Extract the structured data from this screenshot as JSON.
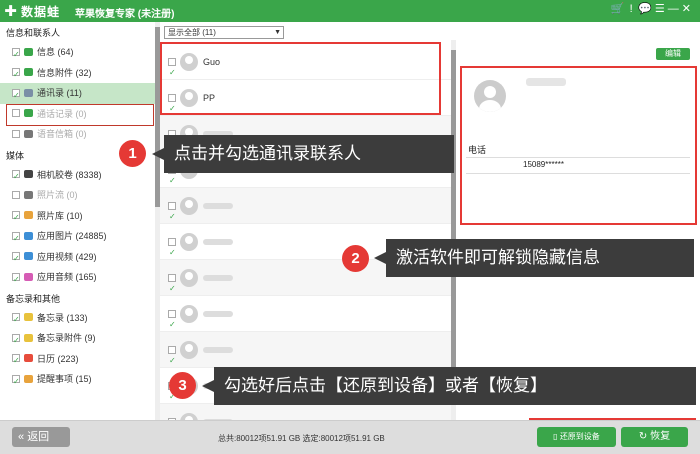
{
  "app": {
    "logo_text": "数据蛙",
    "title": "苹果恢复专家 (未注册)",
    "window_icons": [
      "🛒",
      "!",
      "💬",
      "☰",
      "—",
      "✕"
    ]
  },
  "search": {
    "placeholder": "搜索"
  },
  "sidebar": {
    "sections": [
      {
        "title": "信息和联系人",
        "items": [
          {
            "label": "信息 (64)",
            "checked": true,
            "color": "#3aa64a",
            "selected": false,
            "disabled": false
          },
          {
            "label": "信息附件 (32)",
            "checked": true,
            "color": "#3aa64a",
            "selected": false,
            "disabled": false
          },
          {
            "label": "通讯录 (11)",
            "checked": true,
            "color": "#7a8fa6",
            "selected": true,
            "disabled": false
          },
          {
            "label": "通话记录 (0)",
            "checked": false,
            "color": "#3aa64a",
            "selected": false,
            "disabled": true
          },
          {
            "label": "语音信箱 (0)",
            "checked": false,
            "color": "#777777",
            "selected": false,
            "disabled": true
          }
        ]
      },
      {
        "title": "媒体",
        "items": [
          {
            "label": "相机胶卷 (8338)",
            "checked": true,
            "color": "#444444",
            "selected": false,
            "disabled": false
          },
          {
            "label": "照片流 (0)",
            "checked": false,
            "color": "#777777",
            "selected": false,
            "disabled": true
          },
          {
            "label": "照片库 (10)",
            "checked": true,
            "color": "#e8a33c",
            "selected": false,
            "disabled": false
          },
          {
            "label": "应用图片 (24885)",
            "checked": true,
            "color": "#3d8fd6",
            "selected": false,
            "disabled": false
          },
          {
            "label": "应用视频 (429)",
            "checked": true,
            "color": "#3d8fd6",
            "selected": false,
            "disabled": false
          },
          {
            "label": "应用音频 (165)",
            "checked": true,
            "color": "#d65cb5",
            "selected": false,
            "disabled": false
          }
        ]
      },
      {
        "title": "备忘录和其他",
        "items": [
          {
            "label": "备忘录 (133)",
            "checked": true,
            "color": "#e8c23c",
            "selected": false,
            "disabled": false
          },
          {
            "label": "备忘录附件 (9)",
            "checked": true,
            "color": "#e8c23c",
            "selected": false,
            "disabled": false
          },
          {
            "label": "日历 (223)",
            "checked": true,
            "color": "#e74c3c",
            "selected": false,
            "disabled": false
          },
          {
            "label": "提醒事项 (15)",
            "checked": true,
            "color": "#e8a33c",
            "selected": false,
            "disabled": false
          }
        ]
      }
    ]
  },
  "filter": {
    "value": "显示全部 (11)"
  },
  "contacts": [
    {
      "name": "Guo",
      "checked": true,
      "blurred": false
    },
    {
      "name": "PP",
      "checked": true,
      "blurred": false
    },
    {
      "name": "",
      "checked": true,
      "blurred": true
    },
    {
      "name": "",
      "checked": true,
      "blurred": true
    },
    {
      "name": "",
      "checked": true,
      "blurred": true
    },
    {
      "name": "",
      "checked": true,
      "blurred": true
    },
    {
      "name": "",
      "checked": true,
      "blurred": true
    },
    {
      "name": "",
      "checked": true,
      "blurred": true
    },
    {
      "name": "",
      "checked": true,
      "blurred": true
    },
    {
      "name": "",
      "checked": true,
      "blurred": true
    },
    {
      "name": "",
      "checked": true,
      "blurred": true
    }
  ],
  "detail": {
    "edit_label": "编辑",
    "phone_label": "电话",
    "phone_value": "15089******"
  },
  "callouts": [
    {
      "num": "1",
      "text": "点击并勾选通讯录联系人"
    },
    {
      "num": "2",
      "text": "激活软件即可解锁隐藏信息"
    },
    {
      "num": "3",
      "text": "勾选好后点击【还原到设备】或者【恢复】"
    }
  ],
  "bottom": {
    "back_label": "返回",
    "totals": "总共:80012项51.91 GB 选定:80012项51.91 GB",
    "restore_device_label": "还原到设备",
    "recover_label": "恢复"
  },
  "colors": {
    "accent": "#3aa64a",
    "highlight": "#e53935",
    "callout_bg": "#3c3c3c"
  }
}
